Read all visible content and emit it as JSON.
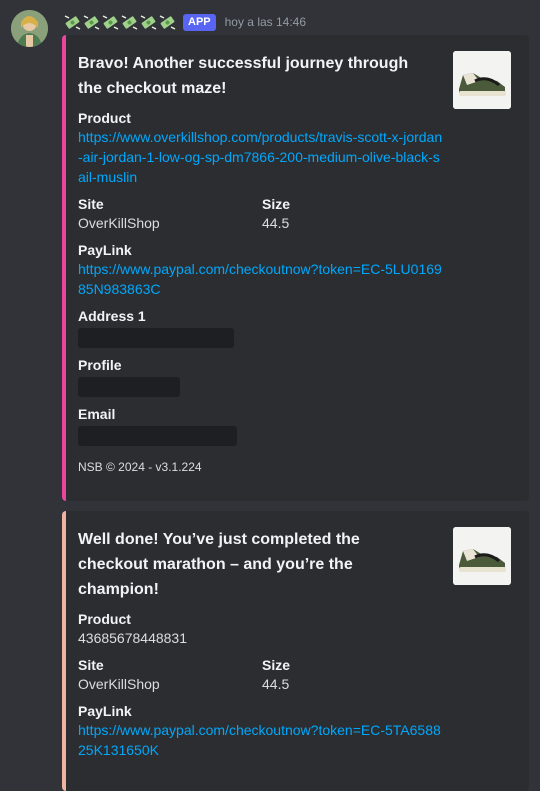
{
  "header": {
    "emoji_count": 6,
    "app_badge": "APP",
    "timestamp": "hoy a las 14:46"
  },
  "embeds": [
    {
      "accent": "#eb459e",
      "title": "Bravo! Another successful journey through the checkout maze!",
      "product_label": "Product",
      "product_value": "https://www.overkillshop.com/products/travis-scott-x-jordan-air-jordan-1-low-og-sp-dm7866-200-medium-olive-black-sail-muslin",
      "site_label": "Site",
      "site_value": "OverKillShop",
      "size_label": "Size",
      "size_value": "44.5",
      "paylink_label": "PayLink",
      "paylink_value": "https://www.paypal.com/checkoutnow?token=EC-5LU016985N983863C",
      "address_label": "Address 1",
      "profile_label": "Profile",
      "email_label": "Email",
      "footer": "NSB © 2024 - v3.1.224"
    },
    {
      "accent": "#f0b2a1",
      "title": "Well done! You’ve just completed the checkout marathon – and you’re the champion!",
      "product_label": "Product",
      "product_value": "43685678448831",
      "site_label": "Site",
      "site_value": "OverKillShop",
      "size_label": "Size",
      "size_value": "44.5",
      "paylink_label": "PayLink",
      "paylink_value": "https://www.paypal.com/checkoutnow?token=EC-5TA658825K131650K"
    }
  ]
}
